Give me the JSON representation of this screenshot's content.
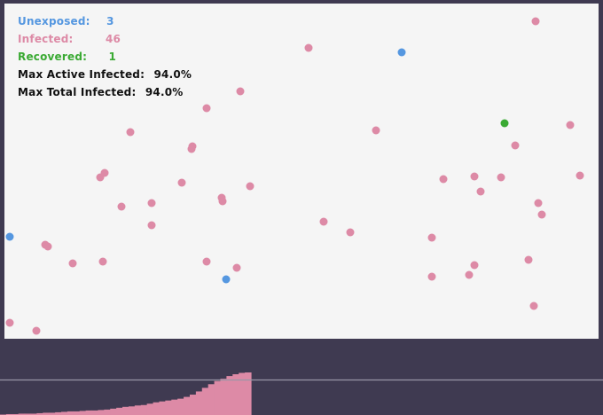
{
  "colors": {
    "unexposed": "#5597e0",
    "infected": "#dd8aa6",
    "recovered": "#3aaa33",
    "black": "#111111",
    "graph_bg": "#3f3a51",
    "graph_line": "#9a96a6"
  },
  "stats": {
    "unexposed": {
      "label": "Unexposed:",
      "value": "3"
    },
    "infected": {
      "label": "Infected:",
      "value": "46"
    },
    "recovered": {
      "label": "Recovered:",
      "value": "1"
    },
    "max_active": {
      "label": "Max Active Infected:",
      "value": "94.0%"
    },
    "max_total": {
      "label": "Max Total Infected:",
      "value": "94.0%"
    }
  },
  "graph": {
    "max_fraction": 0.94,
    "samples": [
      0.01,
      0.02,
      0.02,
      0.03,
      0.03,
      0.03,
      0.04,
      0.05,
      0.05,
      0.06,
      0.07,
      0.08,
      0.08,
      0.09,
      0.1,
      0.1,
      0.11,
      0.12,
      0.14,
      0.16,
      0.18,
      0.19,
      0.21,
      0.22,
      0.25,
      0.28,
      0.3,
      0.32,
      0.34,
      0.36,
      0.4,
      0.45,
      0.52,
      0.6,
      0.68,
      0.75,
      0.8,
      0.86,
      0.9,
      0.93,
      0.94
    ]
  }
}
